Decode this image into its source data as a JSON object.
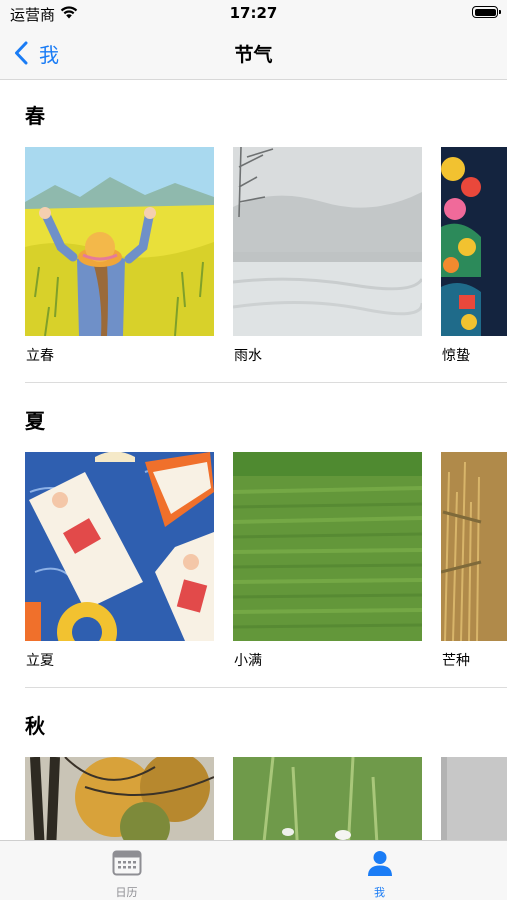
{
  "status_bar": {
    "carrier": "运营商",
    "time": "17:27"
  },
  "nav": {
    "back_label": "我",
    "title": "节气"
  },
  "seasons": [
    {
      "name": "春",
      "terms": [
        "立春",
        "雨水",
        "惊蛰"
      ]
    },
    {
      "name": "夏",
      "terms": [
        "立夏",
        "小满",
        "芒种"
      ]
    },
    {
      "name": "秋",
      "terms": [
        "",
        "",
        ""
      ]
    }
  ],
  "tab_bar": {
    "tabs": [
      {
        "label": "日历",
        "icon": "calendar-icon",
        "selected": false
      },
      {
        "label": "我",
        "icon": "person-icon",
        "selected": true
      }
    ]
  },
  "colors": {
    "accent": "#1a7cf5",
    "inactive_tab": "#8e8e93"
  }
}
